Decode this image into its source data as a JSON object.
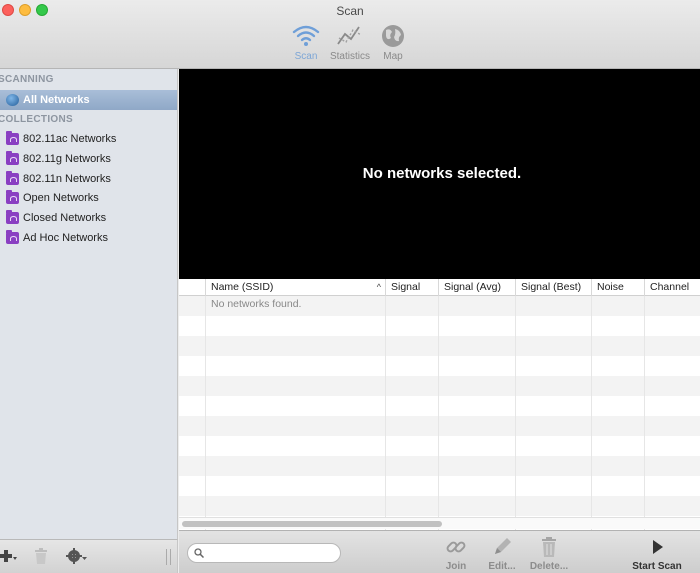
{
  "window": {
    "title": "Scan"
  },
  "toolbar": {
    "scan_label": "Scan",
    "statistics_label": "Statistics",
    "map_label": "Map"
  },
  "sidebar": {
    "scanning_header": "SCANNING",
    "all_networks": "All Networks",
    "collections_header": "COLLECTIONS",
    "collections": [
      "802.11ac Networks",
      "802.11g Networks",
      "802.11n Networks",
      "Open Networks",
      "Closed Networks",
      "Ad Hoc Networks"
    ]
  },
  "detail": {
    "message": "No networks selected."
  },
  "table": {
    "columns": [
      "Name (SSID)",
      "Signal",
      "Signal (Avg)",
      "Signal (Best)",
      "Noise",
      "Channel"
    ],
    "empty_message": "No networks found."
  },
  "bottom_bar": {
    "search_value": "",
    "join_label": "Join",
    "edit_label": "Edit...",
    "delete_label": "Delete...",
    "start_scan_label": "Start Scan"
  },
  "colors": {
    "accent": "#7da6d6",
    "collection_folder": "#8a3fc2",
    "selection": "#98afcc"
  }
}
